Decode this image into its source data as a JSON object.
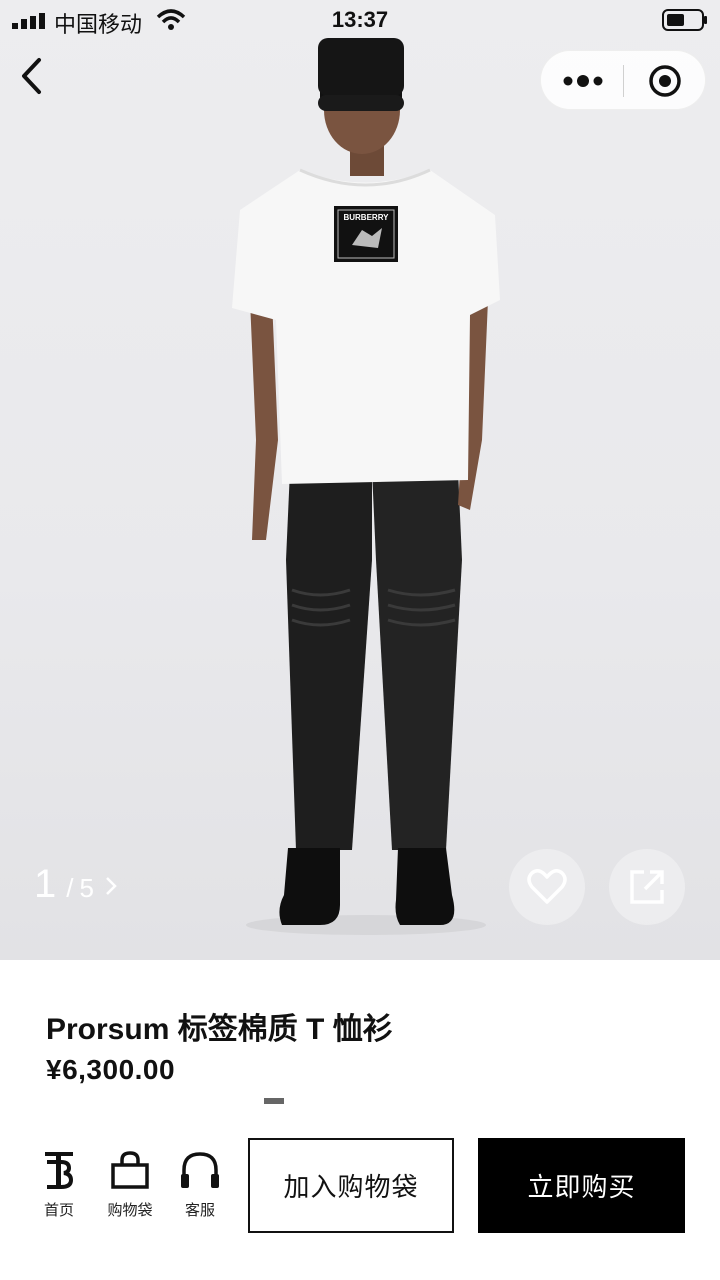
{
  "status_bar": {
    "carrier": "中国移动",
    "time": "13:37"
  },
  "gallery": {
    "current": "1",
    "separator": "/",
    "total": "5"
  },
  "product": {
    "title": "Prorsum 标签棉质 T 恤衫",
    "price": "¥6,300.00",
    "patch_brand": "BURBERRY"
  },
  "tabbar": {
    "home_label": "首页",
    "bag_label": "购物袋",
    "service_label": "客服"
  },
  "actions": {
    "add_to_bag": "加入购物袋",
    "buy_now": "立即购买"
  },
  "colors": {
    "primary": "#000000",
    "background": "#ffffff",
    "hero_bg": "#ebebed"
  },
  "icons": [
    "signal-icon",
    "wifi-icon",
    "battery-icon",
    "back-icon",
    "more-icon",
    "target-icon",
    "chevron-right-icon",
    "heart-icon",
    "share-icon",
    "tb-logo-icon",
    "bag-icon",
    "headset-icon"
  ]
}
